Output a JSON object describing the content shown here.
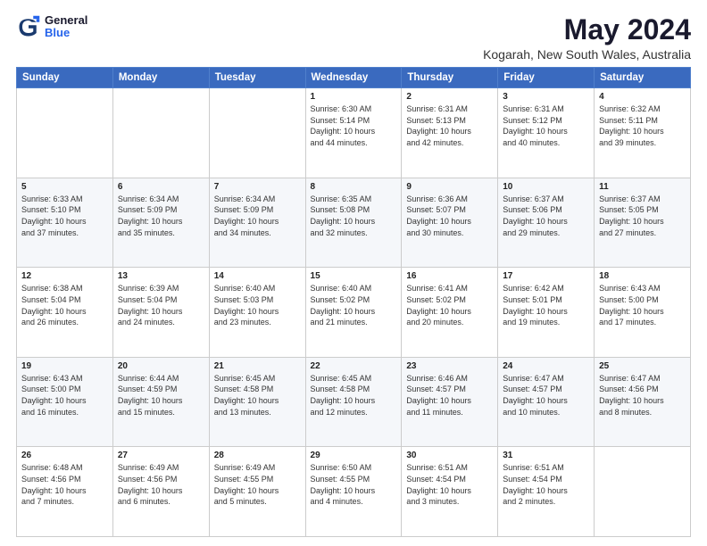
{
  "logo": {
    "general": "General",
    "blue": "Blue"
  },
  "title": "May 2024",
  "subtitle": "Kogarah, New South Wales, Australia",
  "weekdays": [
    "Sunday",
    "Monday",
    "Tuesday",
    "Wednesday",
    "Thursday",
    "Friday",
    "Saturday"
  ],
  "weeks": [
    [
      {
        "day": "",
        "info": ""
      },
      {
        "day": "",
        "info": ""
      },
      {
        "day": "",
        "info": ""
      },
      {
        "day": "1",
        "info": "Sunrise: 6:30 AM\nSunset: 5:14 PM\nDaylight: 10 hours\nand 44 minutes."
      },
      {
        "day": "2",
        "info": "Sunrise: 6:31 AM\nSunset: 5:13 PM\nDaylight: 10 hours\nand 42 minutes."
      },
      {
        "day": "3",
        "info": "Sunrise: 6:31 AM\nSunset: 5:12 PM\nDaylight: 10 hours\nand 40 minutes."
      },
      {
        "day": "4",
        "info": "Sunrise: 6:32 AM\nSunset: 5:11 PM\nDaylight: 10 hours\nand 39 minutes."
      }
    ],
    [
      {
        "day": "5",
        "info": "Sunrise: 6:33 AM\nSunset: 5:10 PM\nDaylight: 10 hours\nand 37 minutes."
      },
      {
        "day": "6",
        "info": "Sunrise: 6:34 AM\nSunset: 5:09 PM\nDaylight: 10 hours\nand 35 minutes."
      },
      {
        "day": "7",
        "info": "Sunrise: 6:34 AM\nSunset: 5:09 PM\nDaylight: 10 hours\nand 34 minutes."
      },
      {
        "day": "8",
        "info": "Sunrise: 6:35 AM\nSunset: 5:08 PM\nDaylight: 10 hours\nand 32 minutes."
      },
      {
        "day": "9",
        "info": "Sunrise: 6:36 AM\nSunset: 5:07 PM\nDaylight: 10 hours\nand 30 minutes."
      },
      {
        "day": "10",
        "info": "Sunrise: 6:37 AM\nSunset: 5:06 PM\nDaylight: 10 hours\nand 29 minutes."
      },
      {
        "day": "11",
        "info": "Sunrise: 6:37 AM\nSunset: 5:05 PM\nDaylight: 10 hours\nand 27 minutes."
      }
    ],
    [
      {
        "day": "12",
        "info": "Sunrise: 6:38 AM\nSunset: 5:04 PM\nDaylight: 10 hours\nand 26 minutes."
      },
      {
        "day": "13",
        "info": "Sunrise: 6:39 AM\nSunset: 5:04 PM\nDaylight: 10 hours\nand 24 minutes."
      },
      {
        "day": "14",
        "info": "Sunrise: 6:40 AM\nSunset: 5:03 PM\nDaylight: 10 hours\nand 23 minutes."
      },
      {
        "day": "15",
        "info": "Sunrise: 6:40 AM\nSunset: 5:02 PM\nDaylight: 10 hours\nand 21 minutes."
      },
      {
        "day": "16",
        "info": "Sunrise: 6:41 AM\nSunset: 5:02 PM\nDaylight: 10 hours\nand 20 minutes."
      },
      {
        "day": "17",
        "info": "Sunrise: 6:42 AM\nSunset: 5:01 PM\nDaylight: 10 hours\nand 19 minutes."
      },
      {
        "day": "18",
        "info": "Sunrise: 6:43 AM\nSunset: 5:00 PM\nDaylight: 10 hours\nand 17 minutes."
      }
    ],
    [
      {
        "day": "19",
        "info": "Sunrise: 6:43 AM\nSunset: 5:00 PM\nDaylight: 10 hours\nand 16 minutes."
      },
      {
        "day": "20",
        "info": "Sunrise: 6:44 AM\nSunset: 4:59 PM\nDaylight: 10 hours\nand 15 minutes."
      },
      {
        "day": "21",
        "info": "Sunrise: 6:45 AM\nSunset: 4:58 PM\nDaylight: 10 hours\nand 13 minutes."
      },
      {
        "day": "22",
        "info": "Sunrise: 6:45 AM\nSunset: 4:58 PM\nDaylight: 10 hours\nand 12 minutes."
      },
      {
        "day": "23",
        "info": "Sunrise: 6:46 AM\nSunset: 4:57 PM\nDaylight: 10 hours\nand 11 minutes."
      },
      {
        "day": "24",
        "info": "Sunrise: 6:47 AM\nSunset: 4:57 PM\nDaylight: 10 hours\nand 10 minutes."
      },
      {
        "day": "25",
        "info": "Sunrise: 6:47 AM\nSunset: 4:56 PM\nDaylight: 10 hours\nand 8 minutes."
      }
    ],
    [
      {
        "day": "26",
        "info": "Sunrise: 6:48 AM\nSunset: 4:56 PM\nDaylight: 10 hours\nand 7 minutes."
      },
      {
        "day": "27",
        "info": "Sunrise: 6:49 AM\nSunset: 4:56 PM\nDaylight: 10 hours\nand 6 minutes."
      },
      {
        "day": "28",
        "info": "Sunrise: 6:49 AM\nSunset: 4:55 PM\nDaylight: 10 hours\nand 5 minutes."
      },
      {
        "day": "29",
        "info": "Sunrise: 6:50 AM\nSunset: 4:55 PM\nDaylight: 10 hours\nand 4 minutes."
      },
      {
        "day": "30",
        "info": "Sunrise: 6:51 AM\nSunset: 4:54 PM\nDaylight: 10 hours\nand 3 minutes."
      },
      {
        "day": "31",
        "info": "Sunrise: 6:51 AM\nSunset: 4:54 PM\nDaylight: 10 hours\nand 2 minutes."
      },
      {
        "day": "",
        "info": ""
      }
    ]
  ]
}
